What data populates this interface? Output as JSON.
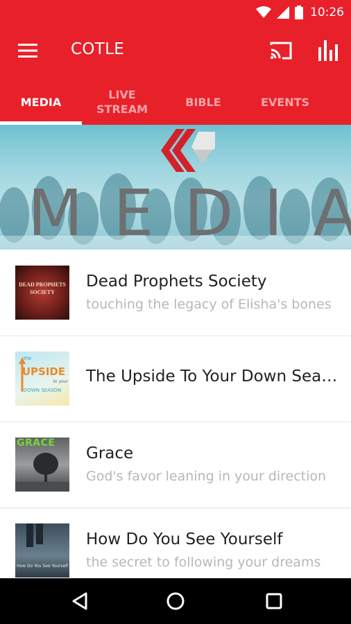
{
  "status": {
    "time": "10:26"
  },
  "app_bar": {
    "title": "COTLE"
  },
  "tabs": [
    {
      "line1": "MEDIA",
      "line2": ""
    },
    {
      "line1": "LIVE",
      "line2": "STREAM"
    },
    {
      "line1": "BIBLE",
      "line2": ""
    },
    {
      "line1": "EVENTS",
      "line2": ""
    }
  ],
  "banner": {
    "text": "MEDIA"
  },
  "series": [
    {
      "title": "Dead Prophets Society",
      "subtitle": "touching the legacy of Elisha's bones",
      "thumb_lines": [
        "DEAD PROPHETS",
        "SOCIETY"
      ]
    },
    {
      "title": "The Upside To Your Down Sea…",
      "subtitle": "",
      "thumb_lines": [
        "the",
        "UPSIDE",
        "to your",
        "DOWN SEASON"
      ]
    },
    {
      "title": "Grace",
      "subtitle": "God's favor leaning in your direction",
      "thumb_lines": [
        "GRACE"
      ]
    },
    {
      "title": "How Do You See Yourself",
      "subtitle": "the secret to following your dreams",
      "thumb_lines": [
        "How Do You See Yourself"
      ]
    }
  ],
  "icons": {
    "menu": "hamburger-icon",
    "cast": "cast-icon",
    "stats": "bar-chart-icon",
    "back": "back-triangle-icon",
    "home": "home-circle-icon",
    "recents": "recents-square-icon"
  },
  "colors": {
    "primary": "#e8202a",
    "text": "#212121",
    "subtext": "#b7b7b7"
  }
}
